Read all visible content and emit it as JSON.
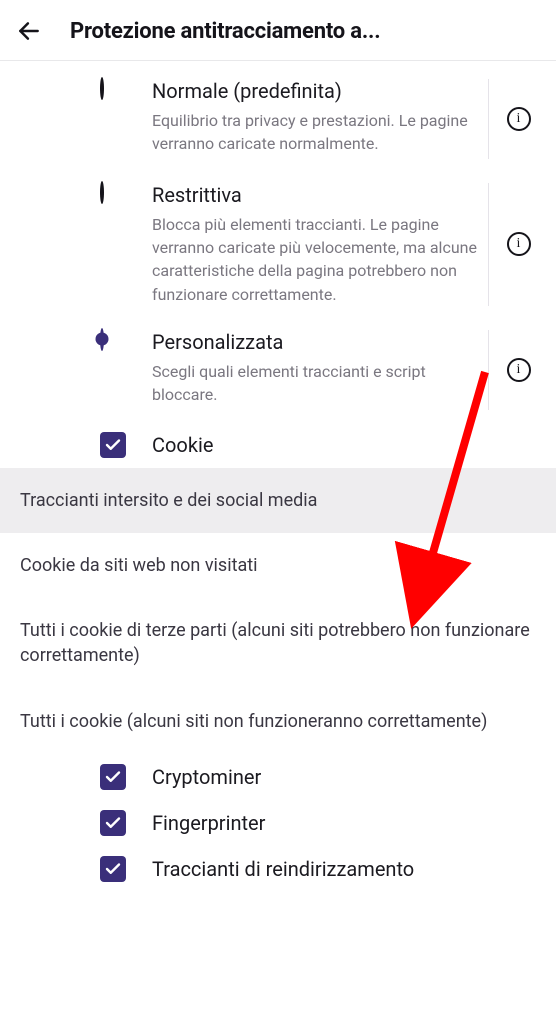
{
  "header": {
    "title": "Protezione antitracciamento a..."
  },
  "options": {
    "normal": {
      "title": "Normale (predefinita)",
      "desc": "Equilibrio tra privacy e prestazioni. Le pagine verranno caricate normalmente."
    },
    "strict": {
      "title": "Restrittiva",
      "desc": "Blocca più elementi traccianti. Le pagine verranno caricate più velocemente, ma alcune caratteristiche della pagina potrebbero non funzionare correttamente."
    },
    "custom": {
      "title": "Personalizzata",
      "desc": "Scegli quali elementi traccianti e script bloccare."
    }
  },
  "custom_checks": {
    "cookie": "Cookie",
    "cryptominer": "Cryptominer",
    "fingerprinter": "Fingerprinter",
    "redirect_trackers": "Traccianti di reindirizzamento"
  },
  "cookie_options": [
    "Traccianti intersito e dei social media",
    "Cookie da siti web non visitati",
    "Tutti i cookie di terze parti (alcuni siti potrebbero non funzionare correttamente)",
    "Tutti i cookie (alcuni siti non funzioneranno correttamente)"
  ],
  "info_glyph": "i"
}
